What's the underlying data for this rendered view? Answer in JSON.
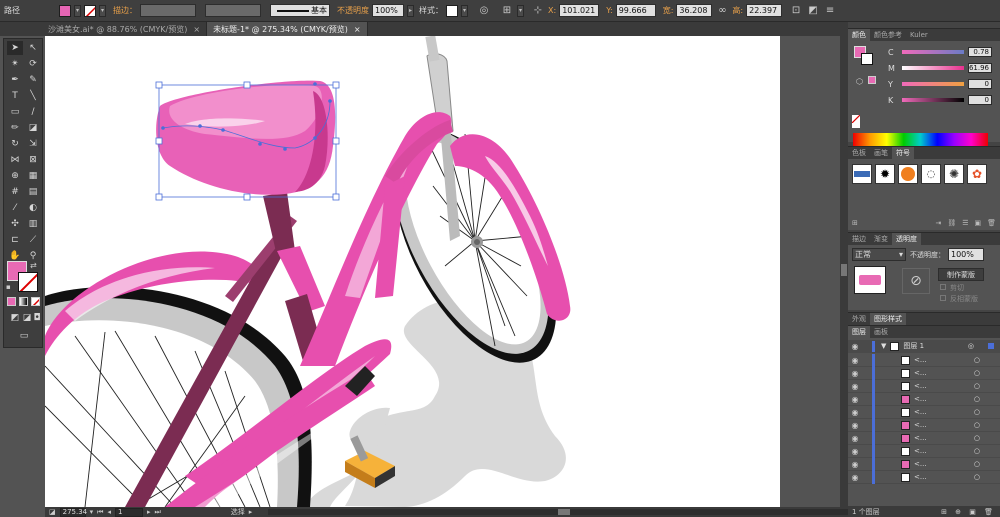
{
  "control_bar": {
    "mode_label": "路径",
    "stroke_label": "描边：",
    "stroke_profile": "基本",
    "opacity_label": "不透明度",
    "opacity_value": "100%",
    "style_label": "样式：",
    "x_label": "X:",
    "x_value": "101.021",
    "y_label": "Y:",
    "y_value": "99.666",
    "w_label": "宽:",
    "w_value": "36.208",
    "h_label": "高:",
    "h_value": "22.397",
    "fill_color": "#e665b4"
  },
  "tabs": [
    {
      "label": "沙滩美女.ai* @ 88.76% (CMYK/预览)",
      "close": "×"
    },
    {
      "label": "未标题-1* @ 275.34% (CMYK/预览)",
      "close": "×"
    }
  ],
  "toolbox": {
    "fill_color": "#e86ab4",
    "stroke_color": "#ffffff"
  },
  "status_bar": {
    "zoom": "275.34",
    "page": "1",
    "tool": "选择"
  },
  "color_panel": {
    "tabs": [
      "颜色",
      "颜色参考",
      "Kuler"
    ],
    "sliders": [
      {
        "label": "C",
        "value": "0.78"
      },
      {
        "label": "M",
        "value": "61.96"
      },
      {
        "label": "Y",
        "value": "0"
      },
      {
        "label": "K",
        "value": "0"
      }
    ]
  },
  "symbols_panel": {
    "tabs": [
      "色板",
      "画笔",
      "符号"
    ],
    "active": "符号"
  },
  "transparency_panel": {
    "tabs": [
      "描边",
      "渐变",
      "透明度"
    ],
    "blend_mode": "正常",
    "opacity_label": "不透明度：",
    "opacity_value": "100%",
    "make_mask": "制作蒙版",
    "clip": "剪切",
    "invert_mask": "反相蒙版"
  },
  "appearance_panel": {
    "tabs": [
      "外观",
      "图形样式"
    ]
  },
  "layers_panel": {
    "tabs": [
      "图层",
      "画板"
    ],
    "layer_name": "图层 1",
    "sublayer_name": "<...",
    "footer": "1 个图层"
  }
}
